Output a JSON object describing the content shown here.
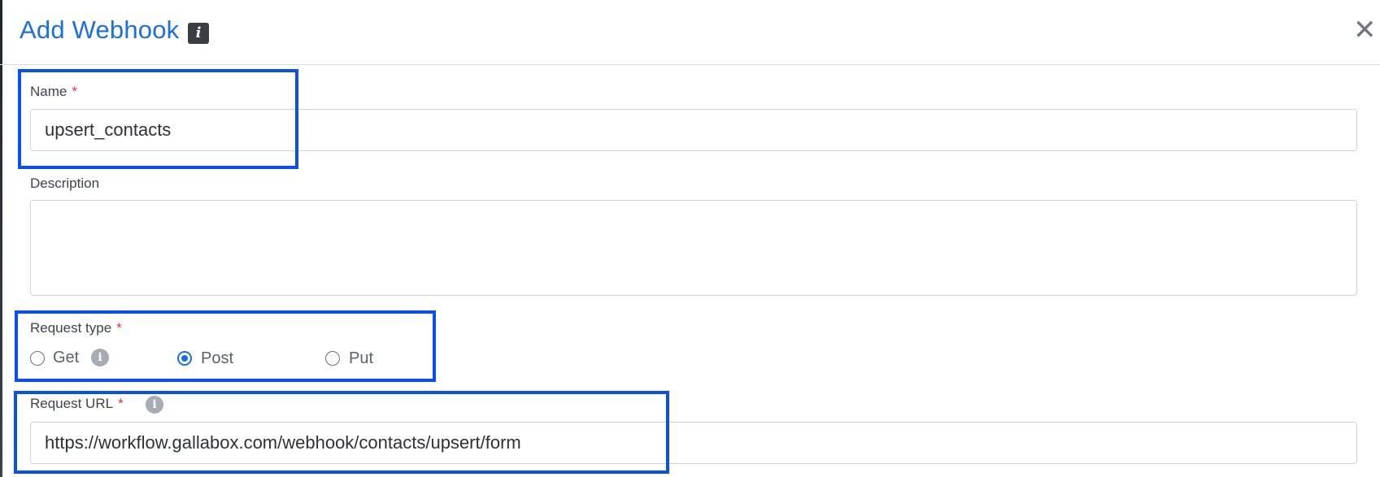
{
  "dialog": {
    "title": "Add Webhook",
    "info_icon": "i",
    "close_icon": "✕"
  },
  "form": {
    "name": {
      "label": "Name",
      "required_mark": "*",
      "value": "upsert_contacts"
    },
    "description": {
      "label": "Description",
      "value": ""
    },
    "request_type": {
      "label": "Request type",
      "required_mark": "*",
      "hint_icon": "i",
      "options": [
        {
          "label": "Get",
          "selected": false
        },
        {
          "label": "Post",
          "selected": true
        },
        {
          "label": "Put",
          "selected": false
        }
      ]
    },
    "request_url": {
      "label": "Request URL",
      "required_mark": "*",
      "hint_icon": "i",
      "value": "https://workflow.gallabox.com/webhook/contacts/upsert/form"
    }
  },
  "colors": {
    "accent": "#1b6fe4",
    "required": "#e0363d",
    "annotation_box": "#0b4ff0"
  }
}
